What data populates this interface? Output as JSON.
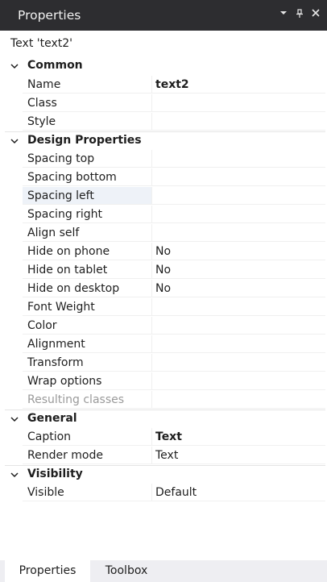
{
  "panel": {
    "title": "Properties"
  },
  "subject": "Text 'text2'",
  "categories": [
    {
      "label": "Common",
      "rows": [
        {
          "name": "Name",
          "value": "text2"
        },
        {
          "name": "Class",
          "value": ""
        },
        {
          "name": "Style",
          "value": ""
        }
      ]
    },
    {
      "label": "Design Properties",
      "rows": [
        {
          "name": "Spacing top",
          "value": ""
        },
        {
          "name": "Spacing bottom",
          "value": ""
        },
        {
          "name": "Spacing left",
          "value": ""
        },
        {
          "name": "Spacing right",
          "value": ""
        },
        {
          "name": "Align self",
          "value": ""
        },
        {
          "name": "Hide on phone",
          "value": "No"
        },
        {
          "name": "Hide on tablet",
          "value": "No"
        },
        {
          "name": "Hide on desktop",
          "value": "No"
        },
        {
          "name": "Font Weight",
          "value": ""
        },
        {
          "name": "Color",
          "value": ""
        },
        {
          "name": "Alignment",
          "value": ""
        },
        {
          "name": "Transform",
          "value": ""
        },
        {
          "name": "Wrap options",
          "value": ""
        },
        {
          "name": "Resulting classes",
          "value": ""
        }
      ]
    },
    {
      "label": "General",
      "rows": [
        {
          "name": "Caption",
          "value": "Text"
        },
        {
          "name": "Render mode",
          "value": "Text"
        }
      ]
    },
    {
      "label": "Visibility",
      "rows": [
        {
          "name": "Visible",
          "value": "Default"
        }
      ]
    }
  ],
  "tabs": {
    "properties": "Properties",
    "toolbox": "Toolbox"
  },
  "icons": {
    "dropdown": "chevron-down-icon",
    "pin": "pin-icon",
    "close": "close-icon",
    "collapse": "chevron-collapse-icon"
  },
  "colors": {
    "titlebar": "#2d2d30",
    "tabbar": "#eeeef2",
    "highlight": "#eef2f8"
  }
}
